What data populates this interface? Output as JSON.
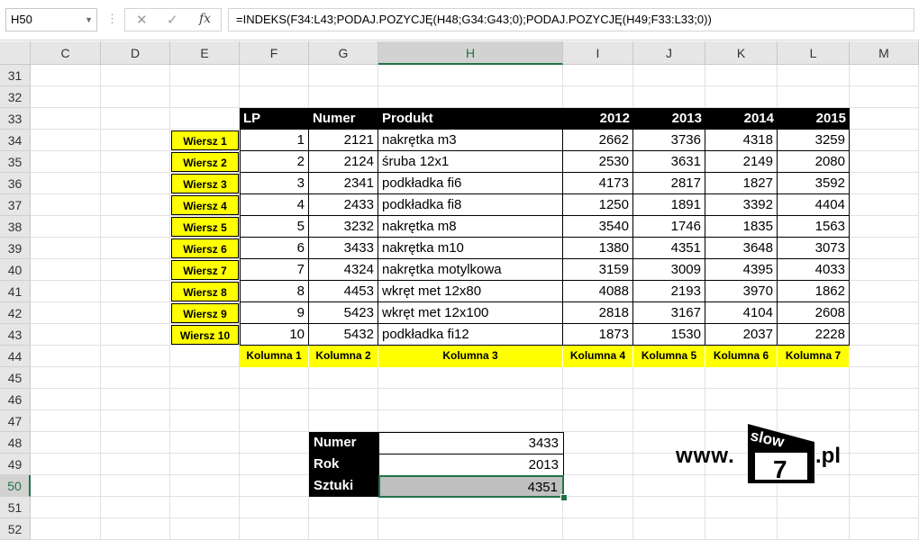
{
  "formula_bar": {
    "name_box": "H50",
    "fx": "fx",
    "formula": "=INDEKS(F34:L43;PODAJ.POZYCJĘ(H48;G34:G43;0);PODAJ.POZYCJĘ(H49;F33:L33;0))"
  },
  "columns": [
    "C",
    "D",
    "E",
    "F",
    "G",
    "H",
    "I",
    "J",
    "K",
    "L",
    "M"
  ],
  "rows": [
    "31",
    "32",
    "33",
    "34",
    "35",
    "36",
    "37",
    "38",
    "39",
    "40",
    "41",
    "42",
    "43",
    "44",
    "45",
    "46",
    "47",
    "48",
    "49",
    "50",
    "51",
    "52"
  ],
  "table": {
    "headers": [
      "LP",
      "Numer",
      "Produkt",
      "2012",
      "2013",
      "2014",
      "2015"
    ],
    "rows": [
      {
        "label": "Wiersz 1",
        "lp": "1",
        "numer": "2121",
        "produkt": "nakrętka m3",
        "y2012": "2662",
        "y2013": "3736",
        "y2014": "4318",
        "y2015": "3259"
      },
      {
        "label": "Wiersz 2",
        "lp": "2",
        "numer": "2124",
        "produkt": "śruba 12x1",
        "y2012": "2530",
        "y2013": "3631",
        "y2014": "2149",
        "y2015": "2080"
      },
      {
        "label": "Wiersz 3",
        "lp": "3",
        "numer": "2341",
        "produkt": "podkładka fi6",
        "y2012": "4173",
        "y2013": "2817",
        "y2014": "1827",
        "y2015": "3592"
      },
      {
        "label": "Wiersz 4",
        "lp": "4",
        "numer": "2433",
        "produkt": "podkładka fi8",
        "y2012": "1250",
        "y2013": "1891",
        "y2014": "3392",
        "y2015": "4404"
      },
      {
        "label": "Wiersz 5",
        "lp": "5",
        "numer": "3232",
        "produkt": "nakrętka m8",
        "y2012": "3540",
        "y2013": "1746",
        "y2014": "1835",
        "y2015": "1563"
      },
      {
        "label": "Wiersz 6",
        "lp": "6",
        "numer": "3433",
        "produkt": "nakrętka m10",
        "y2012": "1380",
        "y2013": "4351",
        "y2014": "3648",
        "y2015": "3073"
      },
      {
        "label": "Wiersz 7",
        "lp": "7",
        "numer": "4324",
        "produkt": "nakrętka motylkowa",
        "y2012": "3159",
        "y2013": "3009",
        "y2014": "4395",
        "y2015": "4033"
      },
      {
        "label": "Wiersz 8",
        "lp": "8",
        "numer": "4453",
        "produkt": "wkręt met 12x80",
        "y2012": "4088",
        "y2013": "2193",
        "y2014": "3970",
        "y2015": "1862"
      },
      {
        "label": "Wiersz 9",
        "lp": "9",
        "numer": "5423",
        "produkt": "wkręt met 12x100",
        "y2012": "2818",
        "y2013": "3167",
        "y2014": "4104",
        "y2015": "2608"
      },
      {
        "label": "Wiersz 10",
        "lp": "10",
        "numer": "5432",
        "produkt": "podkładka fi12",
        "y2012": "1873",
        "y2013": "1530",
        "y2014": "2037",
        "y2015": "2228"
      }
    ],
    "column_labels": [
      "Kolumna 1",
      "Kolumna 2",
      "Kolumna 3",
      "Kolumna 4",
      "Kolumna 5",
      "Kolumna 6",
      "Kolumna 7"
    ]
  },
  "lookup": [
    {
      "label": "Numer",
      "value": "3433"
    },
    {
      "label": "Rok",
      "value": "2013"
    },
    {
      "label": "Sztuki",
      "value": "4351"
    }
  ],
  "logo": {
    "www": "www.",
    "box_top": "slow",
    "box_number": "7",
    "suffix": ".pl"
  },
  "colors": {
    "accent": "#217346",
    "highlight": "#ffff00",
    "header_bg": "#000000"
  }
}
